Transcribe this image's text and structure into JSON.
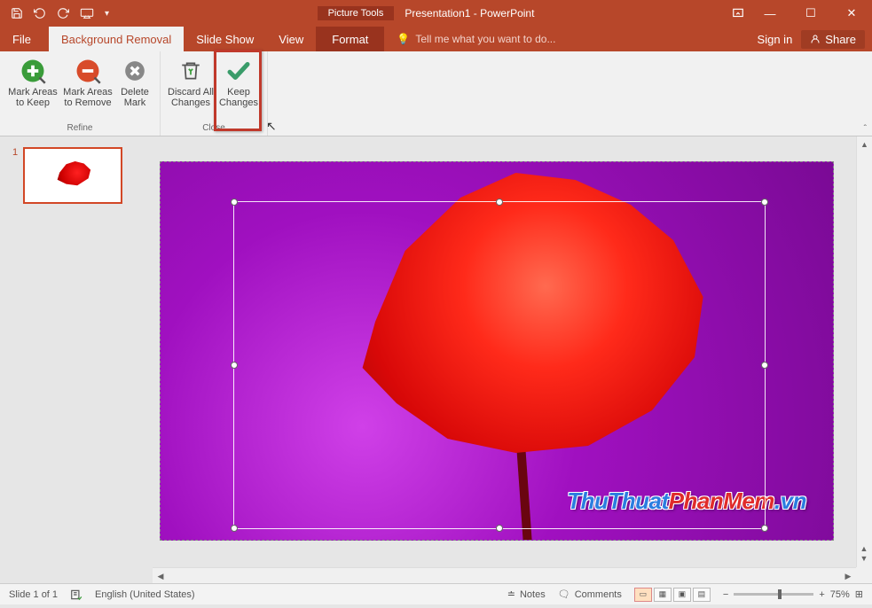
{
  "titlebar": {
    "contextual_label": "Picture Tools",
    "doc_title": "Presentation1 - PowerPoint"
  },
  "tabs": {
    "file": "File",
    "bg_removal": "Background Removal",
    "slideshow": "Slide Show",
    "view": "View",
    "format": "Format",
    "tellme": "Tell me what you want to do...",
    "signin": "Sign in",
    "share": "Share"
  },
  "ribbon": {
    "mark_keep": "Mark Areas to Keep",
    "mark_remove": "Mark Areas to Remove",
    "delete_mark": "Delete Mark",
    "discard": "Discard All Changes",
    "keep": "Keep Changes",
    "group_refine": "Refine",
    "group_close": "Close"
  },
  "thumbs": {
    "slide1_num": "1"
  },
  "watermark": {
    "p1": "ThuThuat",
    "p2": "PhanMem",
    "p3": ".vn"
  },
  "status": {
    "slide_of": "Slide 1 of 1",
    "lang": "English (United States)",
    "notes": "Notes",
    "comments": "Comments",
    "zoom_pct": "75%"
  }
}
